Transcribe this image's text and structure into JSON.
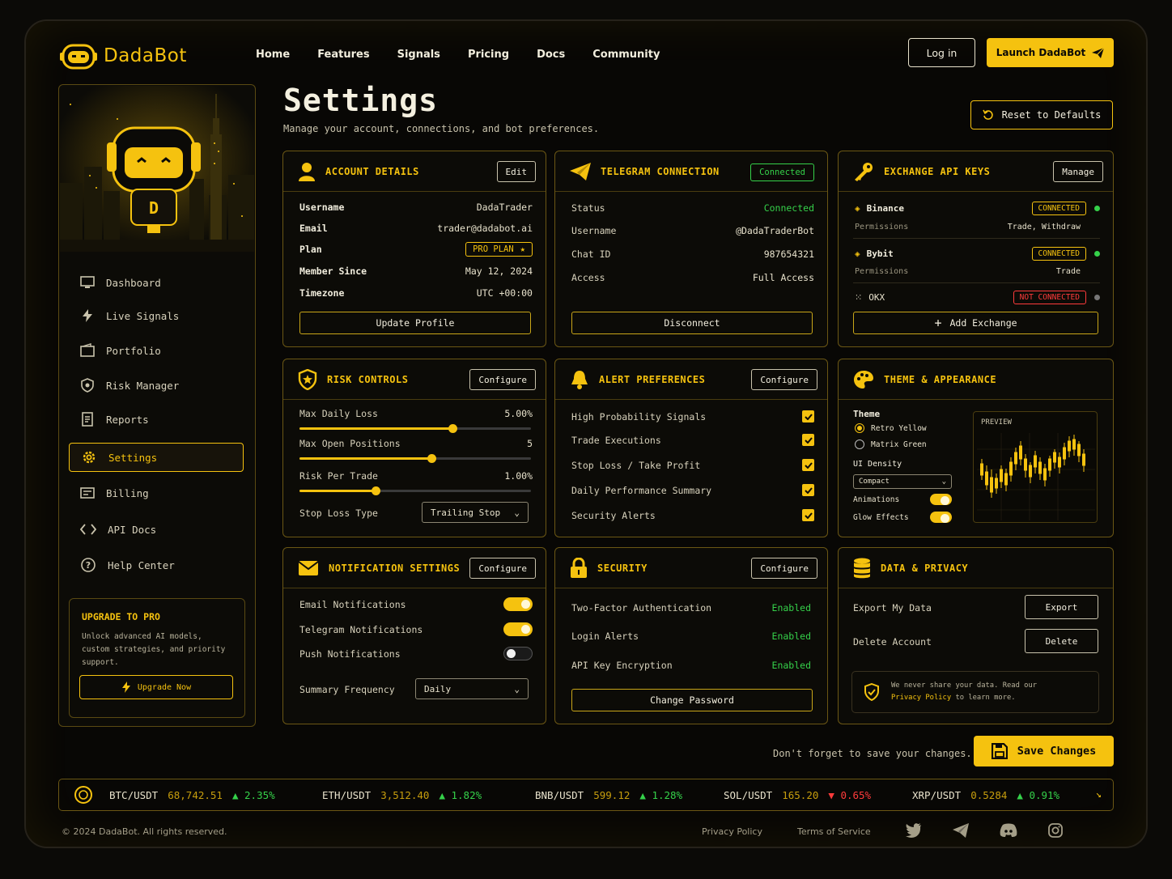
{
  "brand": {
    "name": "DadaBot"
  },
  "nav": [
    "Home",
    "Features",
    "Signals",
    "Pricing",
    "Docs",
    "Community"
  ],
  "header": {
    "login": "Log in",
    "launch": "Launch DadaBot"
  },
  "sidebar": {
    "items": [
      "Dashboard",
      "Live Signals",
      "Portfolio",
      "Risk Manager",
      "Reports",
      "Settings",
      "Billing",
      "API Docs",
      "Help Center"
    ],
    "active": "Settings",
    "upgrade": {
      "title": "UPGRADE TO PRO",
      "text": "Unlock advanced AI models, custom strategies, and priority support.",
      "button": "Upgrade Now"
    }
  },
  "page": {
    "title": "Settings",
    "subtitle": "Manage your account, connections, and bot preferences.",
    "reset": "Reset to Defaults"
  },
  "account": {
    "title": "ACCOUNT DETAILS",
    "edit": "Edit",
    "rows": [
      {
        "k": "Username",
        "v": "DadaTrader"
      },
      {
        "k": "Email",
        "v": "trader@dadabot.ai"
      },
      {
        "k": "Plan",
        "v": "PRO PLAN"
      },
      {
        "k": "Member Since",
        "v": "May 12, 2024"
      },
      {
        "k": "Timezone",
        "v": "UTC +00:00"
      }
    ],
    "button": "Update Profile"
  },
  "telegram": {
    "title": "TELEGRAM CONNECTION",
    "badge": "Connected",
    "rows": [
      {
        "k": "Status",
        "v": "Connected"
      },
      {
        "k": "Username",
        "v": "@DadaTraderBot"
      },
      {
        "k": "Chat ID",
        "v": "987654321"
      },
      {
        "k": "Access",
        "v": "Full Access"
      }
    ],
    "button": "Disconnect"
  },
  "exchange": {
    "title": "EXCHANGE API KEYS",
    "manage": "Manage",
    "items": [
      {
        "name": "Binance",
        "status": "CONNECTED",
        "perm_label": "Permissions",
        "perm": "Trade, Withdraw"
      },
      {
        "name": "Bybit",
        "status": "CONNECTED",
        "perm_label": "Permissions",
        "perm": "Trade"
      },
      {
        "name": "OKX",
        "status": "NOT CONNECTED"
      }
    ],
    "add": "Add Exchange"
  },
  "risk": {
    "title": "RISK CONTROLS",
    "configure": "Configure",
    "sliders": [
      {
        "label": "Max Daily Loss",
        "value": "5.00%",
        "level": 0.66
      },
      {
        "label": "Max Open Positions",
        "value": "5",
        "level": 0.57
      },
      {
        "label": "Risk Per Trade",
        "value": "1.00%",
        "level": 0.33
      }
    ],
    "stop_label": "Stop Loss Type",
    "stop_value": "Trailing Stop"
  },
  "alerts": {
    "title": "ALERT PREFERENCES",
    "configure": "Configure",
    "items": [
      "High Probability Signals",
      "Trade Executions",
      "Stop Loss / Take Profit",
      "Daily Performance Summary",
      "Security Alerts"
    ]
  },
  "theme": {
    "title": "THEME & APPEARANCE",
    "theme_label": "Theme",
    "options": [
      "Retro Yellow",
      "Matrix Green"
    ],
    "selected": "Retro Yellow",
    "density_label": "UI Density",
    "density": "Compact",
    "animations": "Animations",
    "glow": "Glow Effects",
    "preview": "PREVIEW"
  },
  "notifications": {
    "title": "NOTIFICATION SETTINGS",
    "configure": "Configure",
    "items": [
      {
        "label": "Email Notifications",
        "on": true
      },
      {
        "label": "Telegram Notifications",
        "on": true
      },
      {
        "label": "Push Notifications",
        "on": false
      }
    ],
    "freq_label": "Summary Frequency",
    "freq": "Daily"
  },
  "security": {
    "title": "SECURITY",
    "configure": "Configure",
    "rows": [
      {
        "k": "Two-Factor Authentication",
        "v": "Enabled"
      },
      {
        "k": "Login Alerts",
        "v": "Enabled"
      },
      {
        "k": "API Key Encryption",
        "v": "Enabled"
      }
    ],
    "button": "Change Password"
  },
  "privacy": {
    "title": "DATA & PRIVACY",
    "export_label": "Export My Data",
    "export": "Export",
    "delete_label": "Delete Account",
    "delete": "Delete",
    "note_a": "We never share your data. Read our",
    "note_link": "Privacy Policy",
    "note_b": "to learn more."
  },
  "save": {
    "note": "Don't forget to save your changes.",
    "button": "Save Changes"
  },
  "ticker": [
    {
      "pair": "BTC/USDT",
      "price": "68,742.51",
      "change": "2.35%",
      "up": true
    },
    {
      "pair": "ETH/USDT",
      "price": "3,512.40",
      "change": "1.82%",
      "up": true
    },
    {
      "pair": "BNB/USDT",
      "price": "599.12",
      "change": "1.28%",
      "up": true
    },
    {
      "pair": "SOL/USDT",
      "price": "165.20",
      "change": "0.65%",
      "up": false
    },
    {
      "pair": "XRP/USDT",
      "price": "0.5284",
      "change": "0.91%",
      "up": true
    }
  ],
  "footer": {
    "copyright": "© 2024 DadaBot. All rights reserved.",
    "privacy": "Privacy Policy",
    "terms": "Terms of Service",
    "social": [
      "twitter-icon",
      "telegram-icon",
      "discord-icon",
      "instagram-icon"
    ]
  },
  "colors": {
    "accent": "#f5c20f",
    "bg": "#080705",
    "green": "#35d14a",
    "red": "#ff3b3b"
  }
}
